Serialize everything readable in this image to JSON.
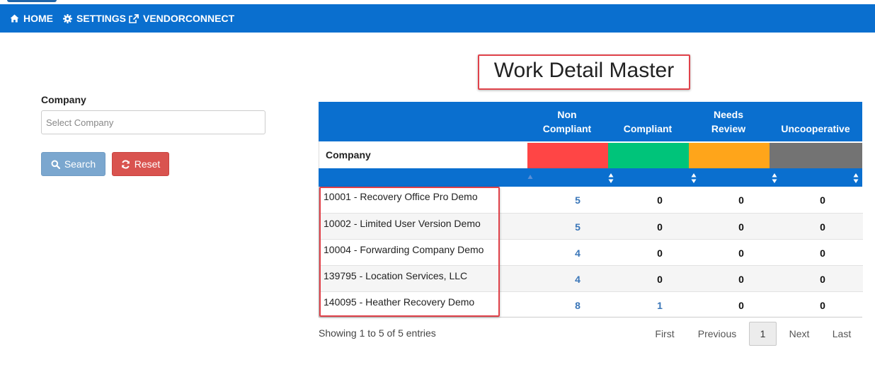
{
  "nav": {
    "home": "HOME",
    "settings": "SETTINGS",
    "vendorconnect": "VENDORCONNECT"
  },
  "filter": {
    "company_label": "Company",
    "company_placeholder": "Select Company",
    "search_label": "Search",
    "reset_label": "Reset"
  },
  "page_title": "Work Detail Master",
  "table": {
    "headers": {
      "non_compliant_line1": "Non",
      "non_compliant_line2": "Compliant",
      "compliant": "Compliant",
      "needs_review_line1": "Needs",
      "needs_review_line2": "Review",
      "uncooperative": "Uncooperative"
    },
    "company_col_label": "Company",
    "status_colors": {
      "non_compliant": "#ff4545",
      "compliant": "#00c47a",
      "needs_review": "#ffa51a",
      "uncooperative": "#737373"
    },
    "rows": [
      {
        "company": "10001 - Recovery Office Pro Demo",
        "non_compliant": "5",
        "compliant": "0",
        "needs_review": "0",
        "uncooperative": "0"
      },
      {
        "company": "10002 - Limited User Version Demo",
        "non_compliant": "5",
        "compliant": "0",
        "needs_review": "0",
        "uncooperative": "0"
      },
      {
        "company": "10004 - Forwarding Company Demo",
        "non_compliant": "4",
        "compliant": "0",
        "needs_review": "0",
        "uncooperative": "0"
      },
      {
        "company": "139795 - Location Services, LLC",
        "non_compliant": "4",
        "compliant": "0",
        "needs_review": "0",
        "uncooperative": "0"
      },
      {
        "company": "140095 - Heather Recovery Demo",
        "non_compliant": "8",
        "compliant": "1",
        "needs_review": "0",
        "uncooperative": "0"
      }
    ]
  },
  "info_text": "Showing 1 to 5 of 5 entries",
  "pagination": {
    "first": "First",
    "previous": "Previous",
    "current": "1",
    "next": "Next",
    "last": "Last"
  }
}
